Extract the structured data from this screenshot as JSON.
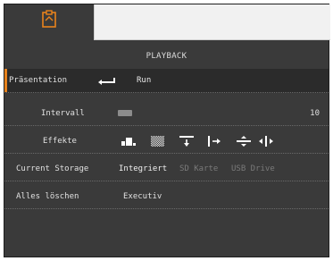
{
  "menu": {
    "title": "PLAYBACK",
    "presentation": {
      "label": "Präsentation",
      "value": "Run"
    },
    "interval": {
      "label": "Intervall",
      "value": "10",
      "level": 0.05
    },
    "effects": {
      "label": "Effekte",
      "items": [
        "block-effect-icon",
        "dissolve-effect-icon",
        "wipe-down-icon",
        "wipe-right-icon",
        "split-vertical-icon",
        "split-horizontal-icon"
      ]
    },
    "storage": {
      "label": "Current Storage",
      "options": [
        "Integriert",
        "SD Karte",
        "USB Drive"
      ]
    },
    "delete_all": {
      "label": "Alles löschen",
      "value": "Executiv"
    }
  },
  "colors": {
    "accent": "#e8821c",
    "text": "#e0e0e0",
    "dim": "#7a7a7a",
    "bg": "#3a3a3a"
  }
}
